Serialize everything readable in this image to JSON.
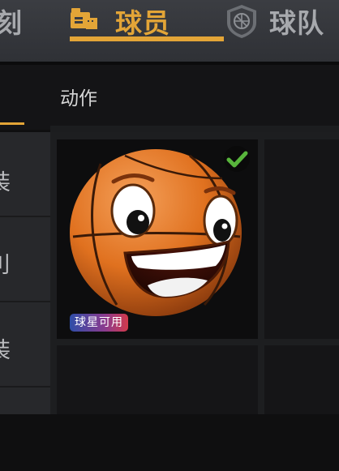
{
  "top_nav": {
    "prev_tab_label": "刻",
    "players_tab_label": "球员",
    "team_tab_label": "球队"
  },
  "section": {
    "title": "动作"
  },
  "left_menu": {
    "items": [
      "装",
      "刂",
      "装",
      ""
    ]
  },
  "cards": [
    {
      "name": "basketball-emote",
      "badge": "球星可用",
      "selected": true
    }
  ],
  "colors": {
    "accent": "#e3a537",
    "check": "#58b53c",
    "ball": "#e0711f"
  }
}
